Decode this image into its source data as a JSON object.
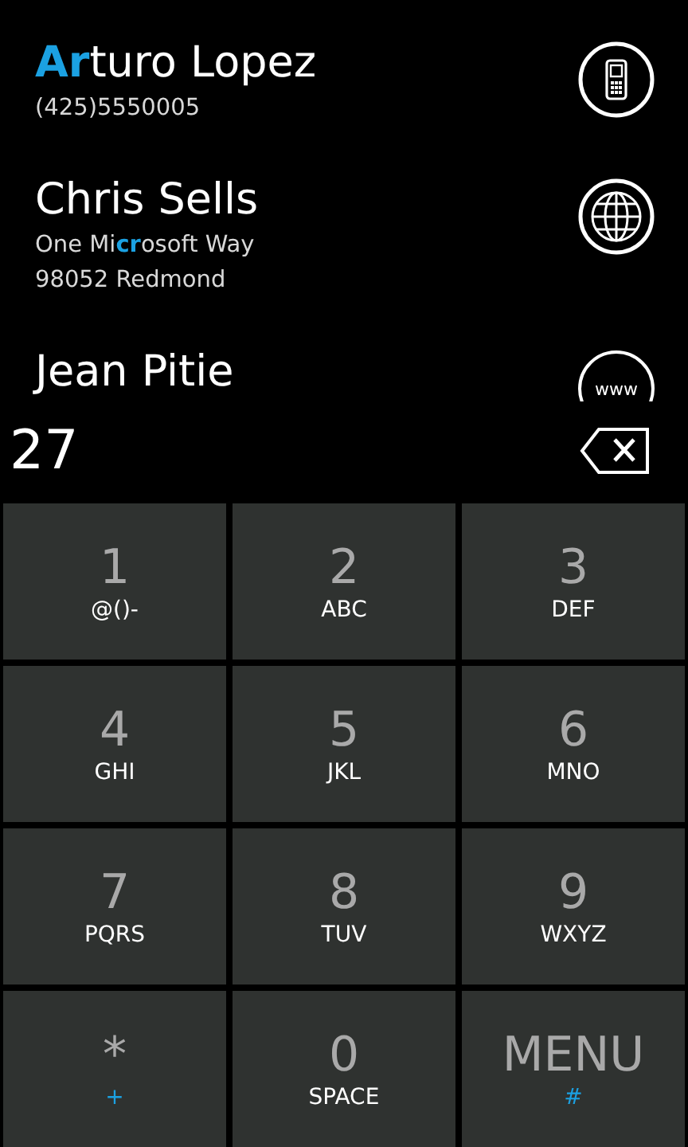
{
  "contacts": [
    {
      "name": "**Ar**turo Lopez",
      "details": [
        "(425)5550005"
      ],
      "action": {
        "kind": "phone"
      }
    },
    {
      "name": "Chris Sells",
      "details": [
        "One Mi**cr**osoft Way",
        "98052 Redmond"
      ],
      "action": {
        "kind": "globe"
      }
    },
    {
      "name": "Jean Pitie",
      "action": {
        "kind": "web",
        "label": "www"
      }
    }
  ],
  "dial_input": {
    "value": "27"
  },
  "keys": [
    {
      "main": "1",
      "sub": "@()-",
      "accent": false
    },
    {
      "main": "2",
      "sub": "ABC",
      "accent": false
    },
    {
      "main": "3",
      "sub": "DEF",
      "accent": false
    },
    {
      "main": "4",
      "sub": "GHI",
      "accent": false
    },
    {
      "main": "5",
      "sub": "JKL",
      "accent": false
    },
    {
      "main": "6",
      "sub": "MNO",
      "accent": false
    },
    {
      "main": "7",
      "sub": "PQRS",
      "accent": false
    },
    {
      "main": "8",
      "sub": "TUV",
      "accent": false
    },
    {
      "main": "9",
      "sub": "WXYZ",
      "accent": false
    },
    {
      "main": "*",
      "sub": "+",
      "accent": true
    },
    {
      "main": "0",
      "sub": "SPACE",
      "accent": false
    },
    {
      "main": "MENU",
      "sub": "#",
      "accent": true
    }
  ]
}
